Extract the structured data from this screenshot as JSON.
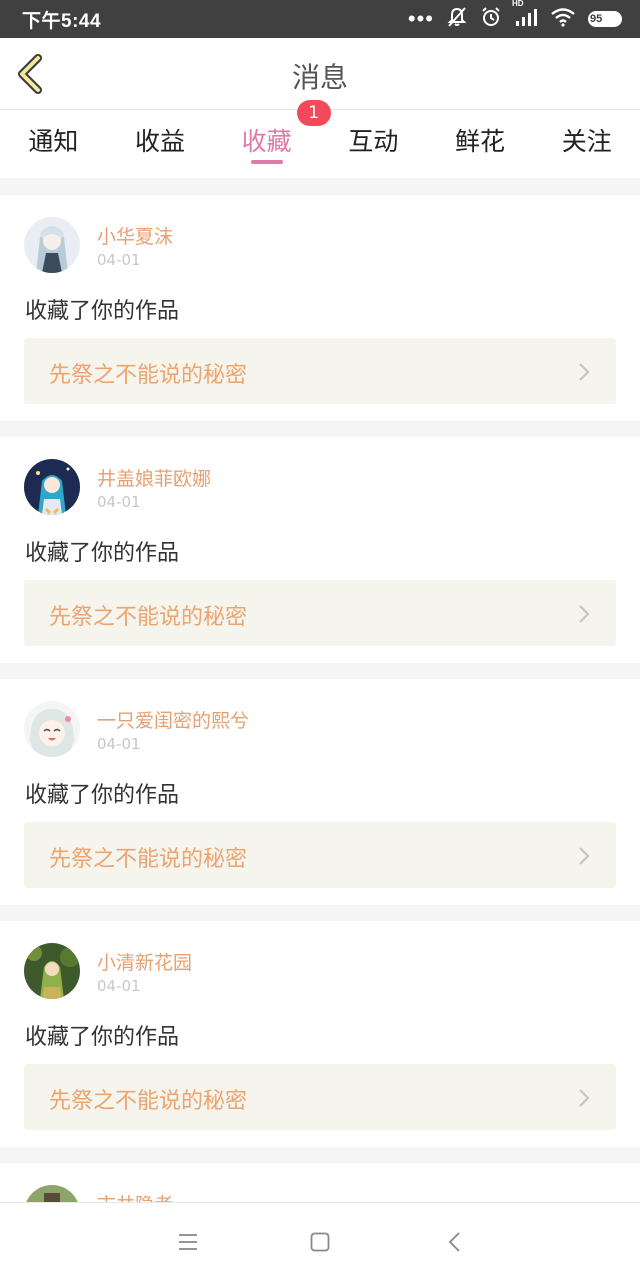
{
  "status_bar": {
    "time": "下午5:44",
    "battery": "95",
    "hd_label": "HD",
    "icons": [
      "more-dots-icon",
      "notifications-off-icon",
      "alarm-icon",
      "hd-signal-icon",
      "wifi-icon",
      "battery-icon"
    ]
  },
  "header": {
    "title": "消息",
    "back_icon": "back-chevron-icon"
  },
  "tabs": [
    {
      "label": "通知",
      "active": false
    },
    {
      "label": "收益",
      "active": false
    },
    {
      "label": "收藏",
      "active": true,
      "badge": "1"
    },
    {
      "label": "互动",
      "active": false
    },
    {
      "label": "鲜花",
      "active": false
    },
    {
      "label": "关注",
      "active": false
    }
  ],
  "colors": {
    "accent_pink": "#e07aa8",
    "badge_red": "#f24a5a",
    "username_orange": "#e8a070",
    "work_title_orange": "#eda46e"
  },
  "messages": [
    {
      "username": "小华夏沫",
      "date": "04-01",
      "action": "收藏了你的作品",
      "work_title": "先祭之不能说的秘密"
    },
    {
      "username": "井盖娘菲欧娜",
      "date": "04-01",
      "action": "收藏了你的作品",
      "work_title": "先祭之不能说的秘密"
    },
    {
      "username": "一只爱闺密的熙兮",
      "date": "04-01",
      "action": "收藏了你的作品",
      "work_title": "先祭之不能说的秘密"
    },
    {
      "username": "小清新花园",
      "date": "04-01",
      "action": "收藏了你的作品",
      "work_title": "先祭之不能说的秘密"
    },
    {
      "username": "市井隐者"
    }
  ],
  "nav_bar": {
    "icons": [
      "menu-icon",
      "home-square-icon",
      "back-triangle-icon"
    ]
  }
}
